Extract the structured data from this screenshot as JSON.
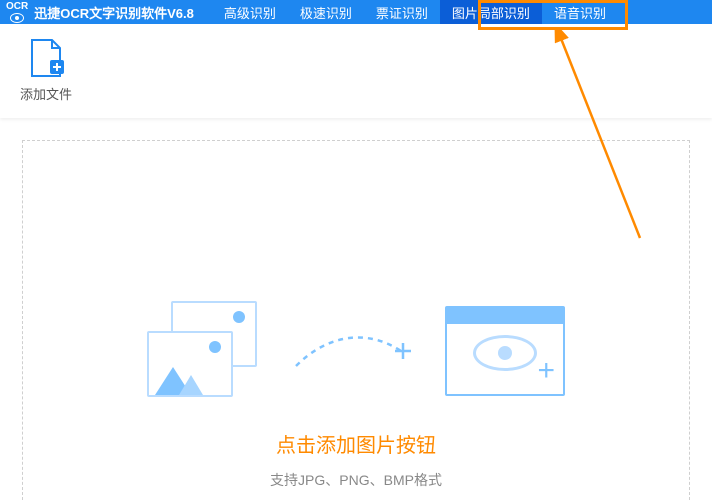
{
  "app": {
    "logo_small": "OCR",
    "title": "迅捷OCR文字识别软件V6.8"
  },
  "nav": {
    "items": [
      {
        "label": "高级识别"
      },
      {
        "label": "极速识别"
      },
      {
        "label": "票证识别"
      },
      {
        "label": "图片局部识别",
        "active": true
      },
      {
        "label": "语音识别"
      }
    ]
  },
  "toolbar": {
    "add_file_label": "添加文件"
  },
  "drop": {
    "cta_title": "点击添加图片按钮",
    "cta_sub": "支持JPG、PNG、BMP格式"
  }
}
